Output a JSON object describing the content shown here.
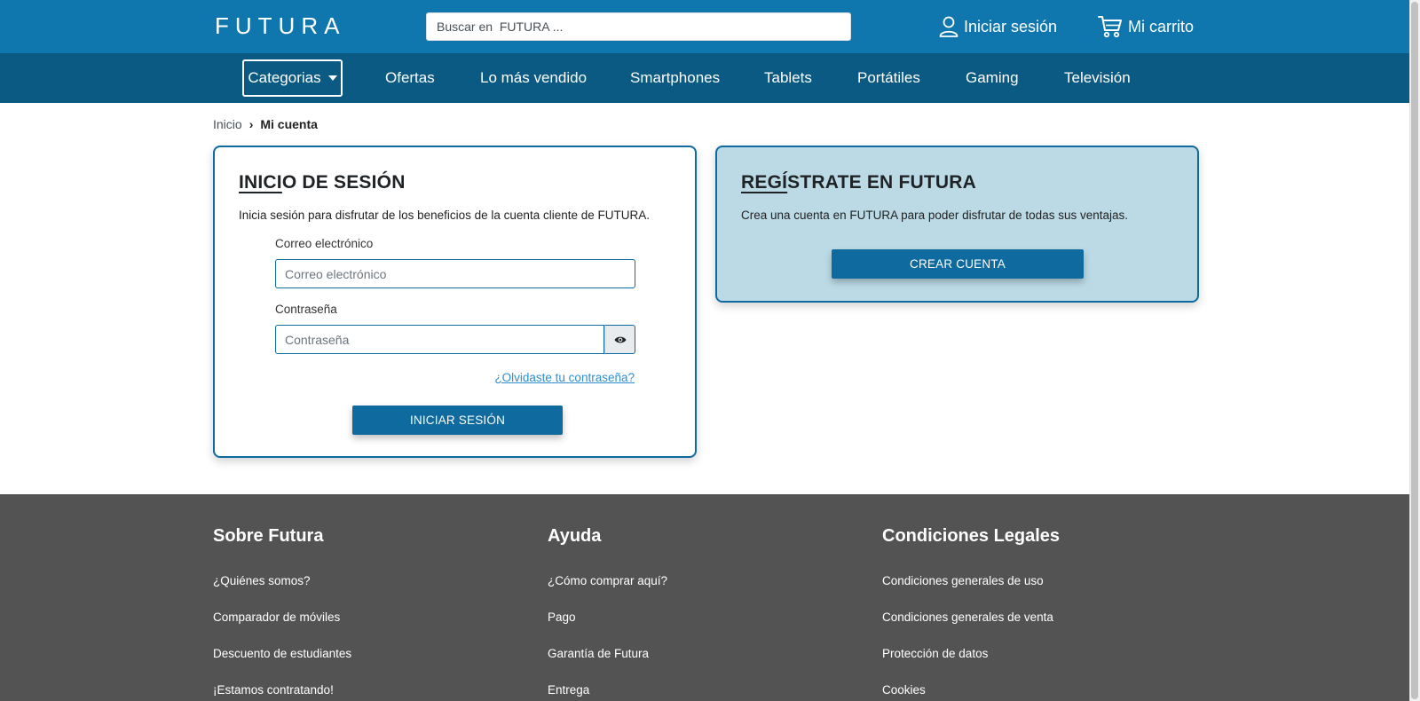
{
  "header": {
    "logo": "FUTURA",
    "search_placeholder": "Buscar en  FUTURA ...",
    "login_label": "Iniciar sesión",
    "cart_label": "Mi carrito"
  },
  "nav": {
    "categories_label": "Categorias",
    "items": [
      "Ofertas",
      "Lo más vendido",
      "Smartphones",
      "Tablets",
      "Portátiles",
      "Gaming",
      "Televisión"
    ]
  },
  "breadcrumb": {
    "home": "Inicio",
    "separator": "›",
    "current": "Mi cuenta"
  },
  "login_card": {
    "title_underlined": "INICI",
    "title_rest": "O DE SESIÓN",
    "description": "Inicia sesión para disfrutar de los beneficios de la cuenta cliente de FUTURA.",
    "email_label": "Correo electrónico",
    "email_placeholder": "Correo electrónico",
    "password_label": "Contraseña",
    "password_placeholder": "Contraseña",
    "forgot_link": "¿Olvidaste tu contraseña?",
    "submit_label": "INICIAR SESIÓN"
  },
  "register_card": {
    "title_underlined": "REGÍ",
    "title_rest": "STRATE EN FUTURA",
    "description": "Crea una cuenta en FUTURA para poder disfrutar de todas sus ventajas.",
    "button_label": "CREAR CUENTA"
  },
  "footer": {
    "columns": [
      {
        "title": "Sobre Futura",
        "links": [
          "¿Quiénes somos?",
          "Comparador de móviles",
          "Descuento de estudiantes",
          "¡Estamos contratando!"
        ]
      },
      {
        "title": "Ayuda",
        "links": [
          "¿Cómo comprar aquí?",
          "Pago",
          "Garantía de Futura",
          "Entrega"
        ]
      },
      {
        "title": "Condiciones Legales",
        "links": [
          "Condiciones generales de uso",
          "Condiciones generales de venta",
          "Protección de datos",
          "Cookies"
        ]
      }
    ]
  },
  "colors": {
    "header_bg": "#0f77ae",
    "nav_bg": "#0a5a83",
    "primary": "#0f6aa0",
    "register_card_bg": "#bcdae5",
    "footer_bg": "#535353",
    "link": "#2d8fd0"
  },
  "icons": [
    "user-icon",
    "cart-icon",
    "eye-icon",
    "caret-down-icon"
  ]
}
